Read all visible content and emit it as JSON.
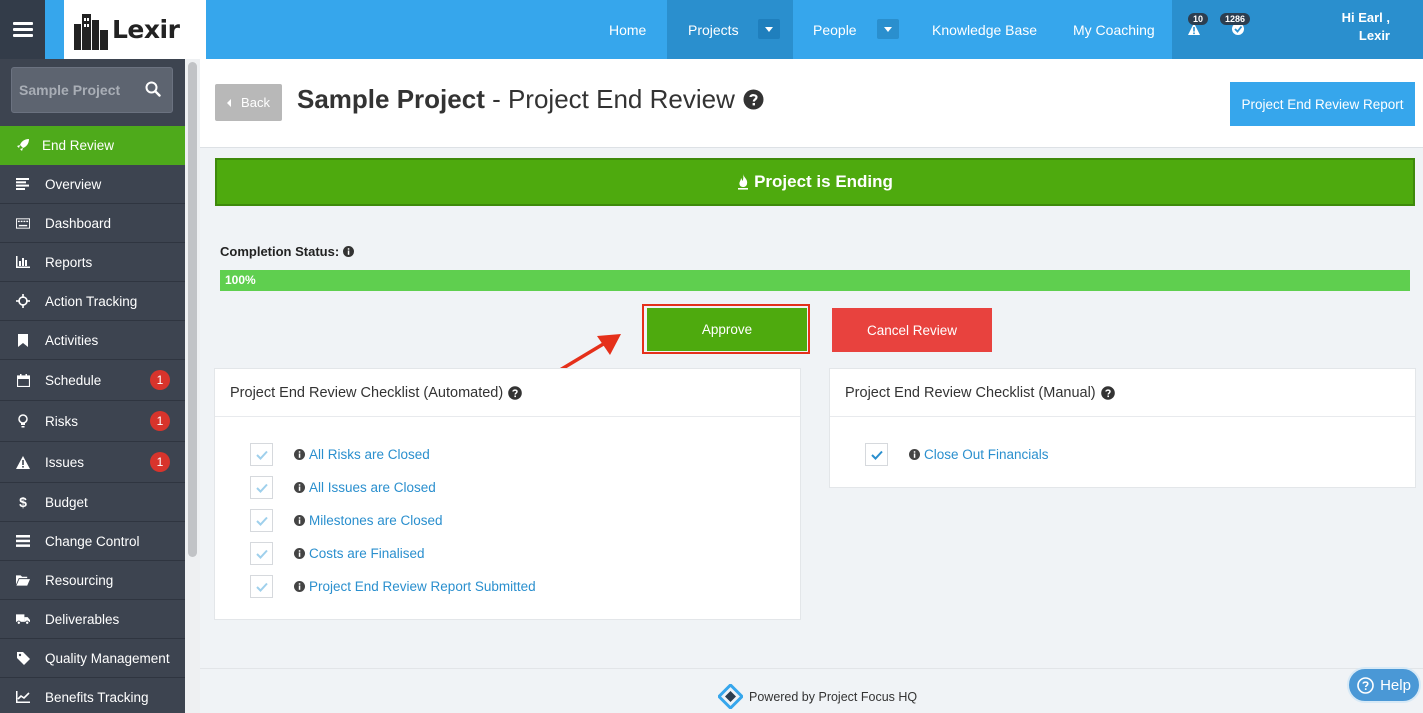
{
  "brand": {
    "logo_text": "Lexir"
  },
  "topnav": {
    "home": "Home",
    "projects": "Projects",
    "people": "People",
    "knowledge_base": "Knowledge Base",
    "my_coaching": "My Coaching",
    "alerts_count": "10",
    "tasks_count": "1286",
    "greeting_line1": "Hi Earl ,",
    "greeting_line2": "Lexir"
  },
  "sidebar": {
    "search_label": "Sample Project",
    "items": [
      {
        "label": "End Review",
        "icon": "rocket-icon"
      },
      {
        "label": "Overview",
        "icon": "align-left-icon"
      },
      {
        "label": "Dashboard",
        "icon": "keyboard-icon"
      },
      {
        "label": "Reports",
        "icon": "bar-chart-icon"
      },
      {
        "label": "Action Tracking",
        "icon": "crosshair-icon"
      },
      {
        "label": "Activities",
        "icon": "bookmark-icon"
      },
      {
        "label": "Schedule",
        "icon": "calendar-icon",
        "badge": "1"
      },
      {
        "label": "Risks",
        "icon": "lightbulb-icon",
        "badge": "1"
      },
      {
        "label": "Issues",
        "icon": "warning-icon",
        "badge": "1"
      },
      {
        "label": "Budget",
        "icon": "dollar-icon"
      },
      {
        "label": "Change Control",
        "icon": "tasks-icon"
      },
      {
        "label": "Resourcing",
        "icon": "folder-open-icon"
      },
      {
        "label": "Deliverables",
        "icon": "truck-icon"
      },
      {
        "label": "Quality Management",
        "icon": "tag-icon"
      },
      {
        "label": "Benefits Tracking",
        "icon": "line-chart-icon"
      }
    ]
  },
  "header": {
    "back": "Back",
    "title_bold": "Sample Project",
    "title_rest": " - Project End Review",
    "report_button": "Project End Review Report"
  },
  "status_banner": "Project is Ending",
  "completion": {
    "label": "Completion Status:",
    "percent_text": "100%",
    "percent": 100
  },
  "actions": {
    "approve": "Approve",
    "cancel": "Cancel Review"
  },
  "automated_checklist": {
    "title": "Project End Review Checklist (Automated)",
    "items": [
      "All Risks are Closed",
      "All Issues are Closed",
      "Milestones are Closed",
      "Costs are Finalised",
      "Project End Review Report Submitted"
    ]
  },
  "manual_checklist": {
    "title": "Project End Review Checklist (Manual)",
    "items": [
      "Close Out Financials"
    ]
  },
  "footer": {
    "powered_by": "Powered by Project Focus HQ",
    "help": "Help"
  },
  "colors": {
    "brand_blue": "#36a6ec",
    "green": "#4eaa0e",
    "red": "#e8423e",
    "sidebar": "#3d4450"
  }
}
